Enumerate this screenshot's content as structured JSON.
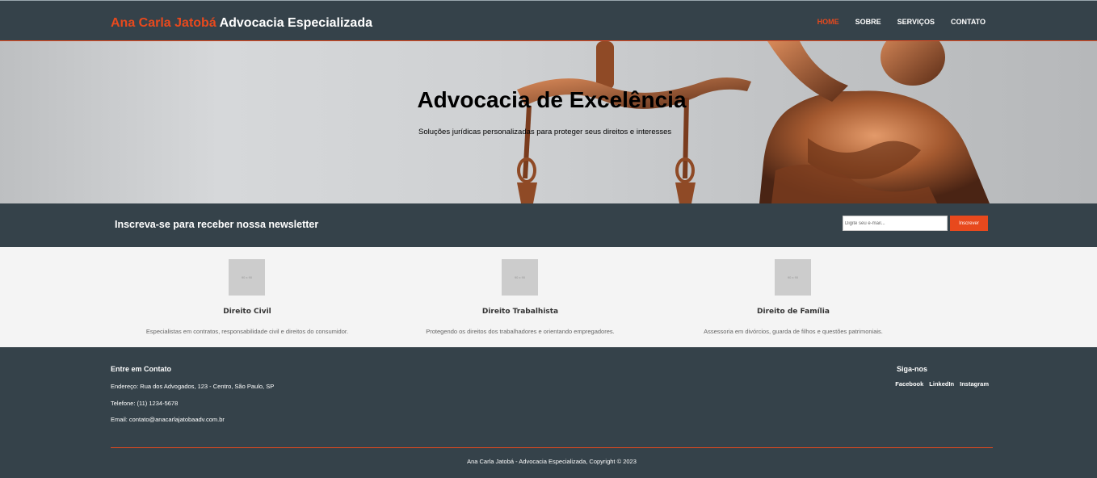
{
  "header": {
    "brand_highlight": "Ana Carla Jatobá",
    "brand_rest": " Advocacia Especializada",
    "nav": [
      {
        "label": "HOME",
        "active": true
      },
      {
        "label": "SOBRE",
        "active": false
      },
      {
        "label": "SERVIÇOS",
        "active": false
      },
      {
        "label": "CONTATO",
        "active": false
      }
    ]
  },
  "hero": {
    "title": "Advocacia de Excelência",
    "subtitle": "Soluções jurídicas personalizadas para proteger seus direitos e interesses"
  },
  "newsletter": {
    "heading": "Inscreva-se para receber nossa newsletter",
    "placeholder": "Digite seu e-mail...",
    "button": "Inscrever"
  },
  "services": [
    {
      "thumb": "90 x 90",
      "title": "Direito Civil",
      "description": "Especialistas em contratos, responsabilidade civil e direitos do consumidor."
    },
    {
      "thumb": "90 x 90",
      "title": "Direito Trabalhista",
      "description": "Protegendo os direitos dos trabalhadores e orientando empregadores."
    },
    {
      "thumb": "90 x 90",
      "title": "Direito de Família",
      "description": "Assessoria em divórcios, guarda de filhos e questões patrimoniais."
    }
  ],
  "footer": {
    "contact_title": "Entre em Contato",
    "address": "Endereço: Rua dos Advogados, 123 - Centro, São Paulo, SP",
    "phone": "Telefone: (11) 1234-5678",
    "email": "Email: contato@anacarlajatobaadv.com.br",
    "follow_title": "Siga-nos",
    "social": [
      "Facebook",
      "LinkedIn",
      "Instagram"
    ],
    "copyright": "Ana Carla Jatobá - Advocacia Especializada, Copyright © 2023"
  },
  "colors": {
    "dark": "#35424a",
    "accent": "#e8491d",
    "light_bg": "#f4f4f4"
  },
  "icons": [
    "scales-of-justice-image"
  ]
}
